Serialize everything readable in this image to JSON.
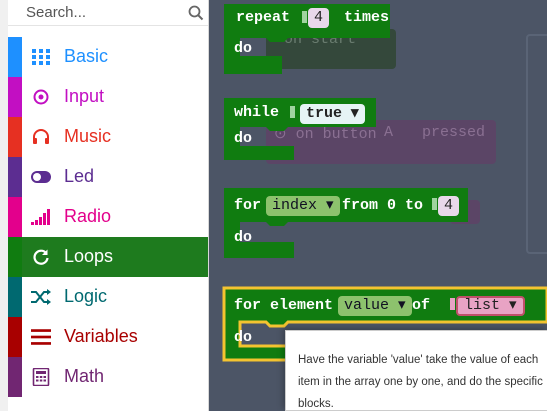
{
  "toolbox": {
    "search_placeholder": "Search...",
    "categories": [
      {
        "label": "Basic",
        "color": "#1e90ff",
        "icon": "grid-icon"
      },
      {
        "label": "Input",
        "color": "#c20fc2",
        "icon": "target-icon"
      },
      {
        "label": "Music",
        "color": "#e63022",
        "icon": "headphones-icon"
      },
      {
        "label": "Led",
        "color": "#5c2d91",
        "icon": "toggle-icon"
      },
      {
        "label": "Radio",
        "color": "#e3008c",
        "icon": "signal-bars-icon"
      },
      {
        "label": "Loops",
        "color": "#107c10",
        "icon": "refresh-icon",
        "selected": true
      },
      {
        "label": "Logic",
        "color": "#006970",
        "icon": "shuffle-icon"
      },
      {
        "label": "Variables",
        "color": "#a80000",
        "icon": "lines-icon"
      },
      {
        "label": "Math",
        "color": "#712672",
        "icon": "calculator-icon"
      }
    ]
  },
  "blocks": {
    "repeat": {
      "keyword": "repeat",
      "count": "4",
      "suffix": "times",
      "do": "do"
    },
    "while": {
      "keyword": "while",
      "condition": "true",
      "do": "do"
    },
    "for_index": {
      "keyword": "for",
      "variable": "index",
      "from": "from 0 to",
      "to": "4",
      "do": "do"
    },
    "for_element": {
      "keyword": "for element",
      "variable": "value",
      "of": "of",
      "list": "list",
      "do": "do"
    }
  },
  "ghost_blocks": {
    "on_start": "on start",
    "on_button": "on button",
    "button_value": "A",
    "pressed": "pressed"
  },
  "tooltip": {
    "text": "Have the variable 'value' take the value of each item in the array one by one, and do the specific blocks."
  },
  "colors": {
    "loop_green": "#107c10",
    "loop_highlight": "#f4c430",
    "variable_green": "#8dc26d",
    "variable_pink": "#e8a3c4",
    "number_pill": "#e8d8ea",
    "boolean_teal": "#5cb8c2",
    "workspace_bg": "#4c5566"
  }
}
